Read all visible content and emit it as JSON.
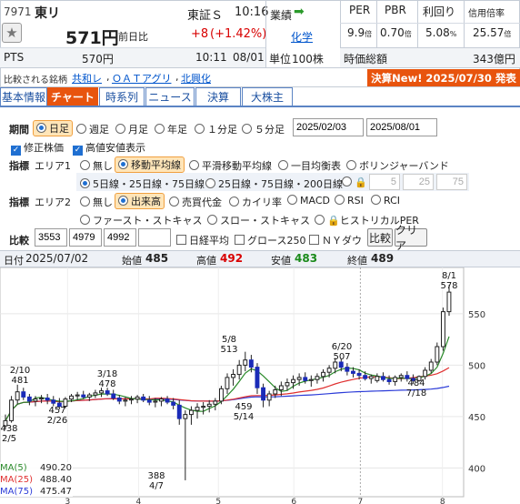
{
  "header": {
    "code": "7971",
    "name": "東リ",
    "exchange": "東証Ｓ",
    "time": "10:16",
    "price": "571円",
    "prev_label": "前日比",
    "change": "+8",
    "change_pct": "(+1.42%)",
    "pts_label": "PTS",
    "pts_price": "570円",
    "pts_time": "10:11",
    "pts_date": "08/01",
    "industry_label": "業績",
    "industry_value": "化学",
    "unit_label": "単位",
    "unit_value": "100株",
    "per_label": "PER",
    "per_value": "9.9",
    "per_unit": "倍",
    "pbr_label": "PBR",
    "pbr_value": "0.70",
    "pbr_unit": "倍",
    "yield_label": "利回り",
    "yield_value": "5.08",
    "yield_unit": "%",
    "margin_label": "信用倍率",
    "margin_value": "25.57",
    "margin_unit": "倍",
    "mcap_label": "時価総額",
    "mcap_value": "343億円"
  },
  "compare": {
    "label": "比較される銘柄",
    "items": [
      "共和レ",
      "ＯＡＴアグリ",
      "北興化"
    ]
  },
  "earnings_banner": "決算New!  2025/07/30 発表",
  "tabs": [
    "基本情報",
    "チャート",
    "時系列",
    "ニュース",
    "決算",
    "大株主"
  ],
  "controls": {
    "period_label": "期間",
    "period_options": [
      "日足",
      "週足",
      "月足",
      "年足",
      "１分足",
      "５分足"
    ],
    "date_from": "2025/02/03",
    "date_to": "2025/08/01",
    "adjusted_label": "修正株価",
    "highres_label": "高値安値表示",
    "indicator_label": "指標",
    "area1_label": "エリア1",
    "area1_options": [
      "無し",
      "移動平均線",
      "平滑移動平均線",
      "一目均衡表",
      "ボリンジャーバンド"
    ],
    "ma_options": [
      "5日線・25日線・75日線",
      "25日線・75日線・200日線"
    ],
    "ma_inputs": [
      "5",
      "25",
      "75"
    ],
    "ma_unit": "日線",
    "area2_label": "エリア2",
    "area2_options": [
      "無し",
      "出来高",
      "売買代金",
      "カイリ率",
      "MACD",
      "RSI",
      "RCI"
    ],
    "area2_options_row2": [
      "ファースト・ストキャス",
      "スロー・ストキャス",
      "ヒストリカルPER"
    ],
    "compare_label": "比較",
    "compare_codes": [
      "3553",
      "4979",
      "4992",
      ""
    ],
    "compare_checks": [
      "日経平均",
      "グロース250",
      "ＮＹダウ"
    ],
    "compare_button": "比較",
    "clear_button": "クリア"
  },
  "ohlc_bar": {
    "date_label": "日付",
    "date": "2025/07/02",
    "open_label": "始値",
    "open": "485",
    "high_label": "高値",
    "high": "492",
    "low_label": "安値",
    "low": "483",
    "close_label": "終値",
    "close": "489"
  },
  "chart": {
    "y_ticks": [
      "550",
      "500",
      "450",
      "400"
    ],
    "x_ticks": [
      "3",
      "4",
      "5",
      "6",
      "7",
      "8"
    ],
    "annotations": [
      {
        "top": "2/10",
        "bottom": "481"
      },
      {
        "top": "3/18",
        "bottom": "478"
      },
      {
        "top": "5/8",
        "bottom": "513"
      },
      {
        "top": "6/20",
        "bottom": "507"
      },
      {
        "top": "8/1",
        "bottom": "578"
      },
      {
        "top": "438",
        "bottom": "2/5"
      },
      {
        "top": "457",
        "bottom": "2/26"
      },
      {
        "top": "459",
        "bottom": "5/14"
      },
      {
        "top": "484",
        "bottom": "7/18"
      },
      {
        "top": "388",
        "bottom": "4/7"
      }
    ],
    "ma_legend": [
      {
        "label": "MA(5)",
        "value": "490.20",
        "color": "#2a8a2a"
      },
      {
        "label": "MA(25)",
        "value": "488.40",
        "color": "#e03030"
      },
      {
        "label": "MA(75)",
        "value": "475.47",
        "color": "#2a3ad8"
      }
    ]
  },
  "chart_data": {
    "type": "candlestick",
    "ylim": [
      372,
      595
    ],
    "candles": [
      [
        441,
        452,
        438,
        446
      ],
      [
        446,
        470,
        444,
        466
      ],
      [
        466,
        481,
        462,
        474
      ],
      [
        474,
        478,
        466,
        469
      ],
      [
        469,
        472,
        461,
        465
      ],
      [
        465,
        470,
        460,
        467
      ],
      [
        467,
        471,
        463,
        468
      ],
      [
        468,
        472,
        462,
        466
      ],
      [
        466,
        470,
        460,
        463
      ],
      [
        463,
        468,
        457,
        460
      ],
      [
        460,
        469,
        458,
        467
      ],
      [
        467,
        472,
        464,
        470
      ],
      [
        470,
        474,
        466,
        471
      ],
      [
        471,
        475,
        467,
        469
      ],
      [
        469,
        473,
        465,
        471
      ],
      [
        471,
        476,
        468,
        473
      ],
      [
        473,
        478,
        469,
        475
      ],
      [
        475,
        478,
        470,
        472
      ],
      [
        472,
        476,
        466,
        468
      ],
      [
        468,
        471,
        462,
        465
      ],
      [
        465,
        469,
        460,
        466
      ],
      [
        466,
        470,
        462,
        467
      ],
      [
        467,
        471,
        463,
        469
      ],
      [
        469,
        472,
        464,
        466
      ],
      [
        466,
        470,
        461,
        464
      ],
      [
        464,
        468,
        459,
        465
      ],
      [
        465,
        469,
        460,
        467
      ],
      [
        467,
        470,
        462,
        464
      ],
      [
        464,
        468,
        457,
        461
      ],
      [
        461,
        466,
        442,
        448
      ],
      [
        448,
        456,
        388,
        452
      ],
      [
        452,
        460,
        442,
        456
      ],
      [
        456,
        463,
        448,
        459
      ],
      [
        459,
        464,
        452,
        460
      ],
      [
        460,
        466,
        454,
        462
      ],
      [
        462,
        468,
        456,
        465
      ],
      [
        465,
        480,
        462,
        477
      ],
      [
        477,
        492,
        472,
        488
      ],
      [
        488,
        496,
        480,
        491
      ],
      [
        491,
        505,
        486,
        500
      ],
      [
        500,
        513,
        494,
        505
      ],
      [
        505,
        510,
        493,
        498
      ],
      [
        498,
        502,
        472,
        478
      ],
      [
        478,
        482,
        459,
        466
      ],
      [
        466,
        475,
        460,
        472
      ],
      [
        472,
        480,
        468,
        476
      ],
      [
        476,
        484,
        470,
        480
      ],
      [
        480,
        487,
        475,
        483
      ],
      [
        483,
        490,
        477,
        486
      ],
      [
        486,
        492,
        480,
        488
      ],
      [
        488,
        493,
        482,
        485
      ],
      [
        485,
        490,
        479,
        486
      ],
      [
        486,
        492,
        482,
        489
      ],
      [
        489,
        496,
        484,
        493
      ],
      [
        493,
        500,
        488,
        497
      ],
      [
        497,
        507,
        492,
        503
      ],
      [
        503,
        506,
        494,
        498
      ],
      [
        498,
        502,
        490,
        494
      ],
      [
        494,
        498,
        488,
        492
      ],
      [
        492,
        496,
        486,
        490
      ],
      [
        490,
        494,
        485,
        487
      ],
      [
        487,
        491,
        482,
        489
      ],
      [
        485,
        492,
        483,
        489
      ],
      [
        489,
        493,
        484,
        486
      ],
      [
        486,
        490,
        481,
        484
      ],
      [
        484,
        490,
        480,
        488
      ],
      [
        488,
        492,
        484,
        490
      ],
      [
        490,
        494,
        484,
        487
      ],
      [
        487,
        491,
        482,
        485
      ],
      [
        485,
        490,
        484,
        489
      ],
      [
        489,
        498,
        486,
        495
      ],
      [
        495,
        506,
        492,
        503
      ],
      [
        503,
        522,
        500,
        518
      ],
      [
        518,
        556,
        514,
        552
      ],
      [
        552,
        578,
        548,
        571
      ]
    ],
    "ma5_end": 490.2,
    "ma25_end": 488.4,
    "ma75_end": 475.47
  }
}
